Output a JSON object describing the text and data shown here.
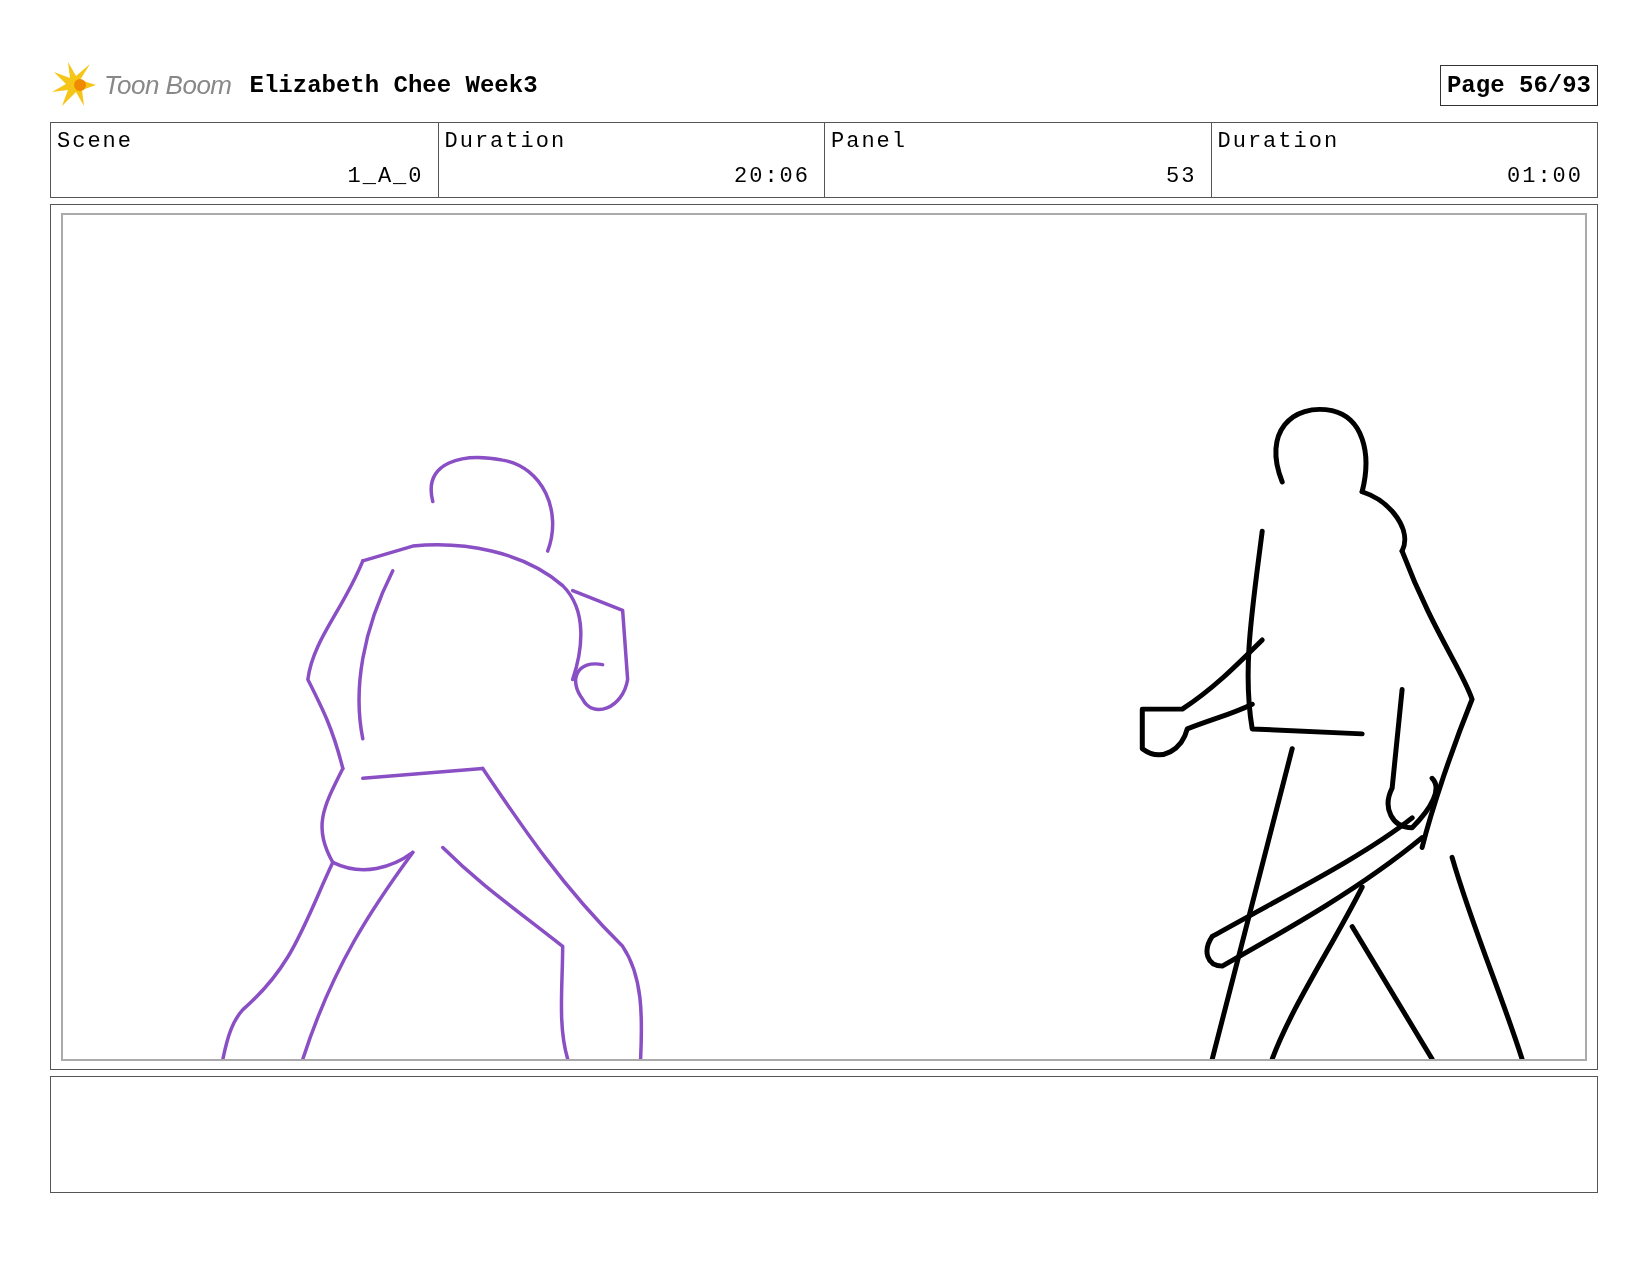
{
  "header": {
    "logo_text": "Toon Boom",
    "title": "Elizabeth Chee Week3",
    "page": "Page 56/93"
  },
  "fields": [
    {
      "label": "Scene",
      "value": "1_A_0"
    },
    {
      "label": "Duration",
      "value": "20:06"
    },
    {
      "label": "Panel",
      "value": "53"
    },
    {
      "label": "Duration",
      "value": "01:00"
    }
  ],
  "panel": {
    "figures": [
      {
        "kind": "back-view",
        "color": "#8a4fc4"
      },
      {
        "kind": "walking",
        "color": "#000000"
      }
    ]
  }
}
